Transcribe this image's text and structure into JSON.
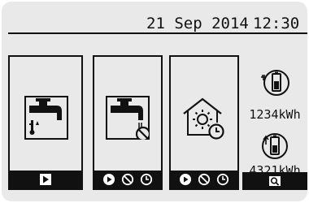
{
  "status": {
    "date": "21 Sep 2014",
    "time": "12:30"
  },
  "panels": [
    {
      "name": "hot-water",
      "icon": "tap-temperature-icon",
      "footer_icons": [
        "play-icon"
      ]
    },
    {
      "name": "water-prohibit",
      "icon": "tap-prohibited-icon",
      "footer_icons": [
        "play-icon",
        "prohibit-icon",
        "clock-icon"
      ]
    },
    {
      "name": "heating-schedule",
      "icon": "house-sun-clock-icon",
      "footer_icons": [
        "play-icon",
        "prohibit-icon",
        "clock-icon"
      ]
    }
  ],
  "energy": {
    "consumed": {
      "icon": "plug-battery-icon",
      "value": "1234kWh"
    },
    "delivered": {
      "icon": "arrow-battery-icon",
      "value": "4321kWh"
    },
    "footer_icon": "magnifier-icon"
  }
}
